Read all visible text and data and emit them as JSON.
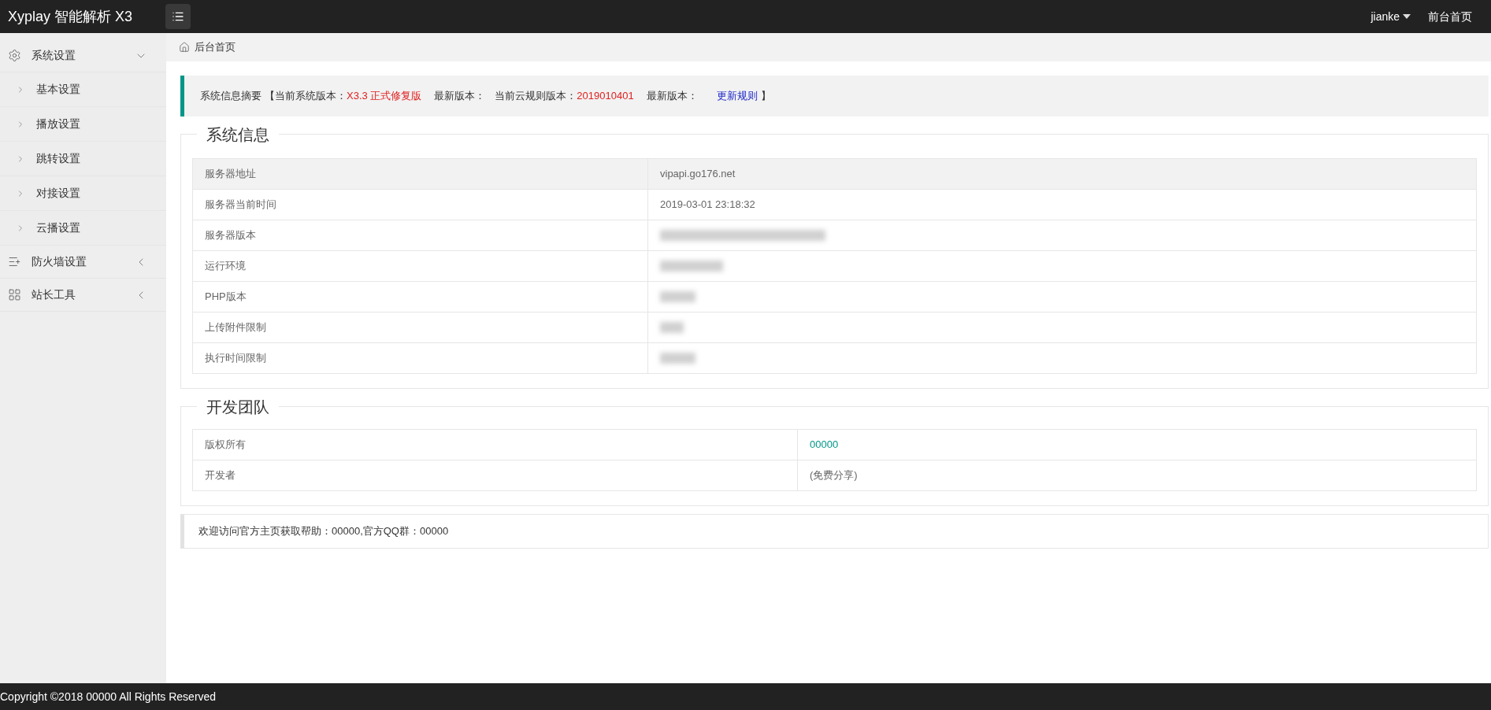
{
  "header": {
    "title": "Xyplay 智能解析 X3",
    "user": "jianke",
    "home_link": "前台首页"
  },
  "sidebar": {
    "items": [
      {
        "label": "系统设置",
        "kind": "gear",
        "expanded": true,
        "children": [
          {
            "label": "基本设置"
          },
          {
            "label": "播放设置"
          },
          {
            "label": "跳转设置"
          },
          {
            "label": "对接设置"
          },
          {
            "label": "云播设置"
          }
        ]
      },
      {
        "label": "防火墙设置",
        "kind": "list",
        "expanded": false
      },
      {
        "label": "站长工具",
        "kind": "grid",
        "expanded": false
      }
    ]
  },
  "breadcrumb": "后台首页",
  "summary": {
    "parts": [
      {
        "kind": "plain",
        "text": "系统信息摘要"
      },
      {
        "kind": "strong",
        "text": "【当前系统版本："
      },
      {
        "kind": "value",
        "text": "X3.3 正式修复版"
      },
      {
        "kind": "strong",
        "text": "最新版本："
      },
      {
        "kind": "strong",
        "text": "当前云规则版本："
      },
      {
        "kind": "value",
        "text": "2019010401"
      },
      {
        "kind": "strong",
        "text": "最新版本："
      },
      {
        "kind": "link",
        "text": "更新规则"
      },
      {
        "kind": "strong",
        "text": "】"
      }
    ]
  },
  "system_info": {
    "title": "系统信息",
    "rows": [
      {
        "label": "服务器地址",
        "value": "vipapi.go176.net",
        "blurred": false
      },
      {
        "label": "服务器当前时间",
        "value": "2019-03-01 23:18:32",
        "blurred": false
      },
      {
        "label": "服务器版本",
        "blurred": true
      },
      {
        "label": "运行环境",
        "blurred": true
      },
      {
        "label": "PHP版本",
        "blurred": true
      },
      {
        "label": "上传附件限制",
        "blurred": true
      },
      {
        "label": "执行时间限制",
        "blurred": true
      }
    ]
  },
  "dev_team": {
    "title": "开发团队",
    "rows": [
      {
        "label": "版权所有",
        "value": "00000",
        "kind": "link"
      },
      {
        "label": "开发者",
        "value": "(免费分享)",
        "kind": "plain"
      }
    ]
  },
  "notice": "欢迎访问官方主页获取帮助：00000,官方QQ群：00000",
  "footer": "Copyright ©2018 00000 All Rights Reserved"
}
